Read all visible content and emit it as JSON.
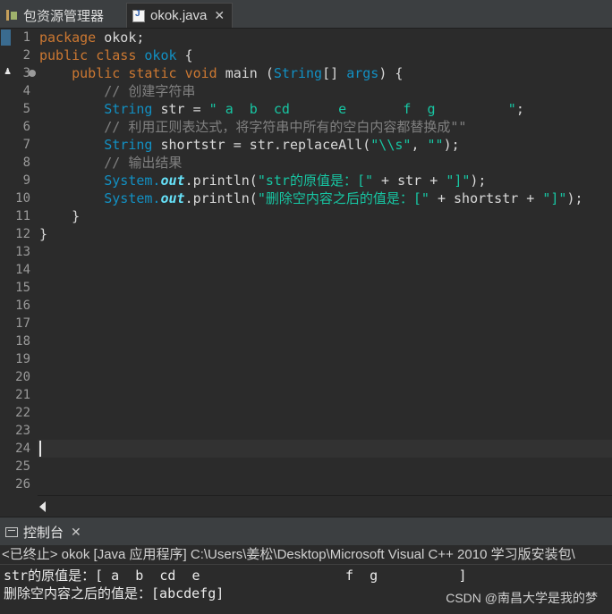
{
  "tabs": [
    {
      "label": "包资源管理器",
      "icon": "package-explorer-icon"
    },
    {
      "label": "okok.java",
      "icon": "java-file-icon",
      "close": "✕"
    }
  ],
  "editor": {
    "line_numbers": [
      "1",
      "2",
      "3",
      "4",
      "5",
      "6",
      "7",
      "8",
      "9",
      "10",
      "11",
      "12",
      "13",
      "14",
      "15",
      "16",
      "17",
      "18",
      "19",
      "20",
      "21",
      "22",
      "23",
      "24",
      "25",
      "26"
    ],
    "code": {
      "l1": {
        "kw": "package",
        "rest": " okok;"
      },
      "l2": {
        "kw1": "public",
        "kw2": "class",
        "cls": "okok",
        "rest": " {"
      },
      "l3": {
        "kw1": "public",
        "kw2": "static",
        "kw3": "void",
        "name": "main",
        "open": " (",
        "type": "String",
        "rest": "[] ",
        "param": "args",
        "close": ") {"
      },
      "l4": {
        "comment": "// 创建字符串"
      },
      "l5": {
        "type": "String",
        "var": " str",
        "eq": " = ",
        "str": "\" a  b  cd      e       f  g         \"",
        "end": ";"
      },
      "l6": {
        "comment": "// 利用正则表达式，将字符串中所有的空白内容都替换成\"\""
      },
      "l7": {
        "type": "String",
        "var": " shortstr",
        "eq": " = str.replaceAll(",
        "str1": "\"\\\\s\"",
        "mid": ", ",
        "str2": "\"\"",
        "end": ");"
      },
      "l8": {
        "comment": "// 输出结果"
      },
      "l9": {
        "sys": "System.",
        "out": "out",
        "call": ".println(",
        "str": "\"str的原值是：[\"",
        "rest": " + str + ",
        "str2": "\"]\"",
        "end": ");"
      },
      "l10": {
        "sys": "System.",
        "out": "out",
        "call": ".println(",
        "str": "\"删除空内容之后的值是：[\"",
        "rest": " + shortstr + ",
        "str2": "\"]\"",
        "end": ");"
      },
      "l11": {
        "text": "}"
      },
      "l12": {
        "text": "}"
      }
    }
  },
  "console": {
    "tab_label": "控制台",
    "close": "✕",
    "status": "<已终止> okok [Java 应用程序] C:\\Users\\姜松\\Desktop\\Microsoft Visual C++ 2010 学习版安装包\\",
    "output": [
      "str的原值是：[ a  b  cd  e                  f  g          ]",
      "删除空内容之后的值是：[abcdefg]"
    ]
  },
  "watermark": "CSDN @南昌大学是我的梦",
  "colors": {
    "background": "#2b2b2b",
    "keyword": "#cc7832",
    "type": "#1290c3",
    "string": "#17c6a3",
    "comment": "#808080",
    "static_field": "#66e1f8"
  }
}
